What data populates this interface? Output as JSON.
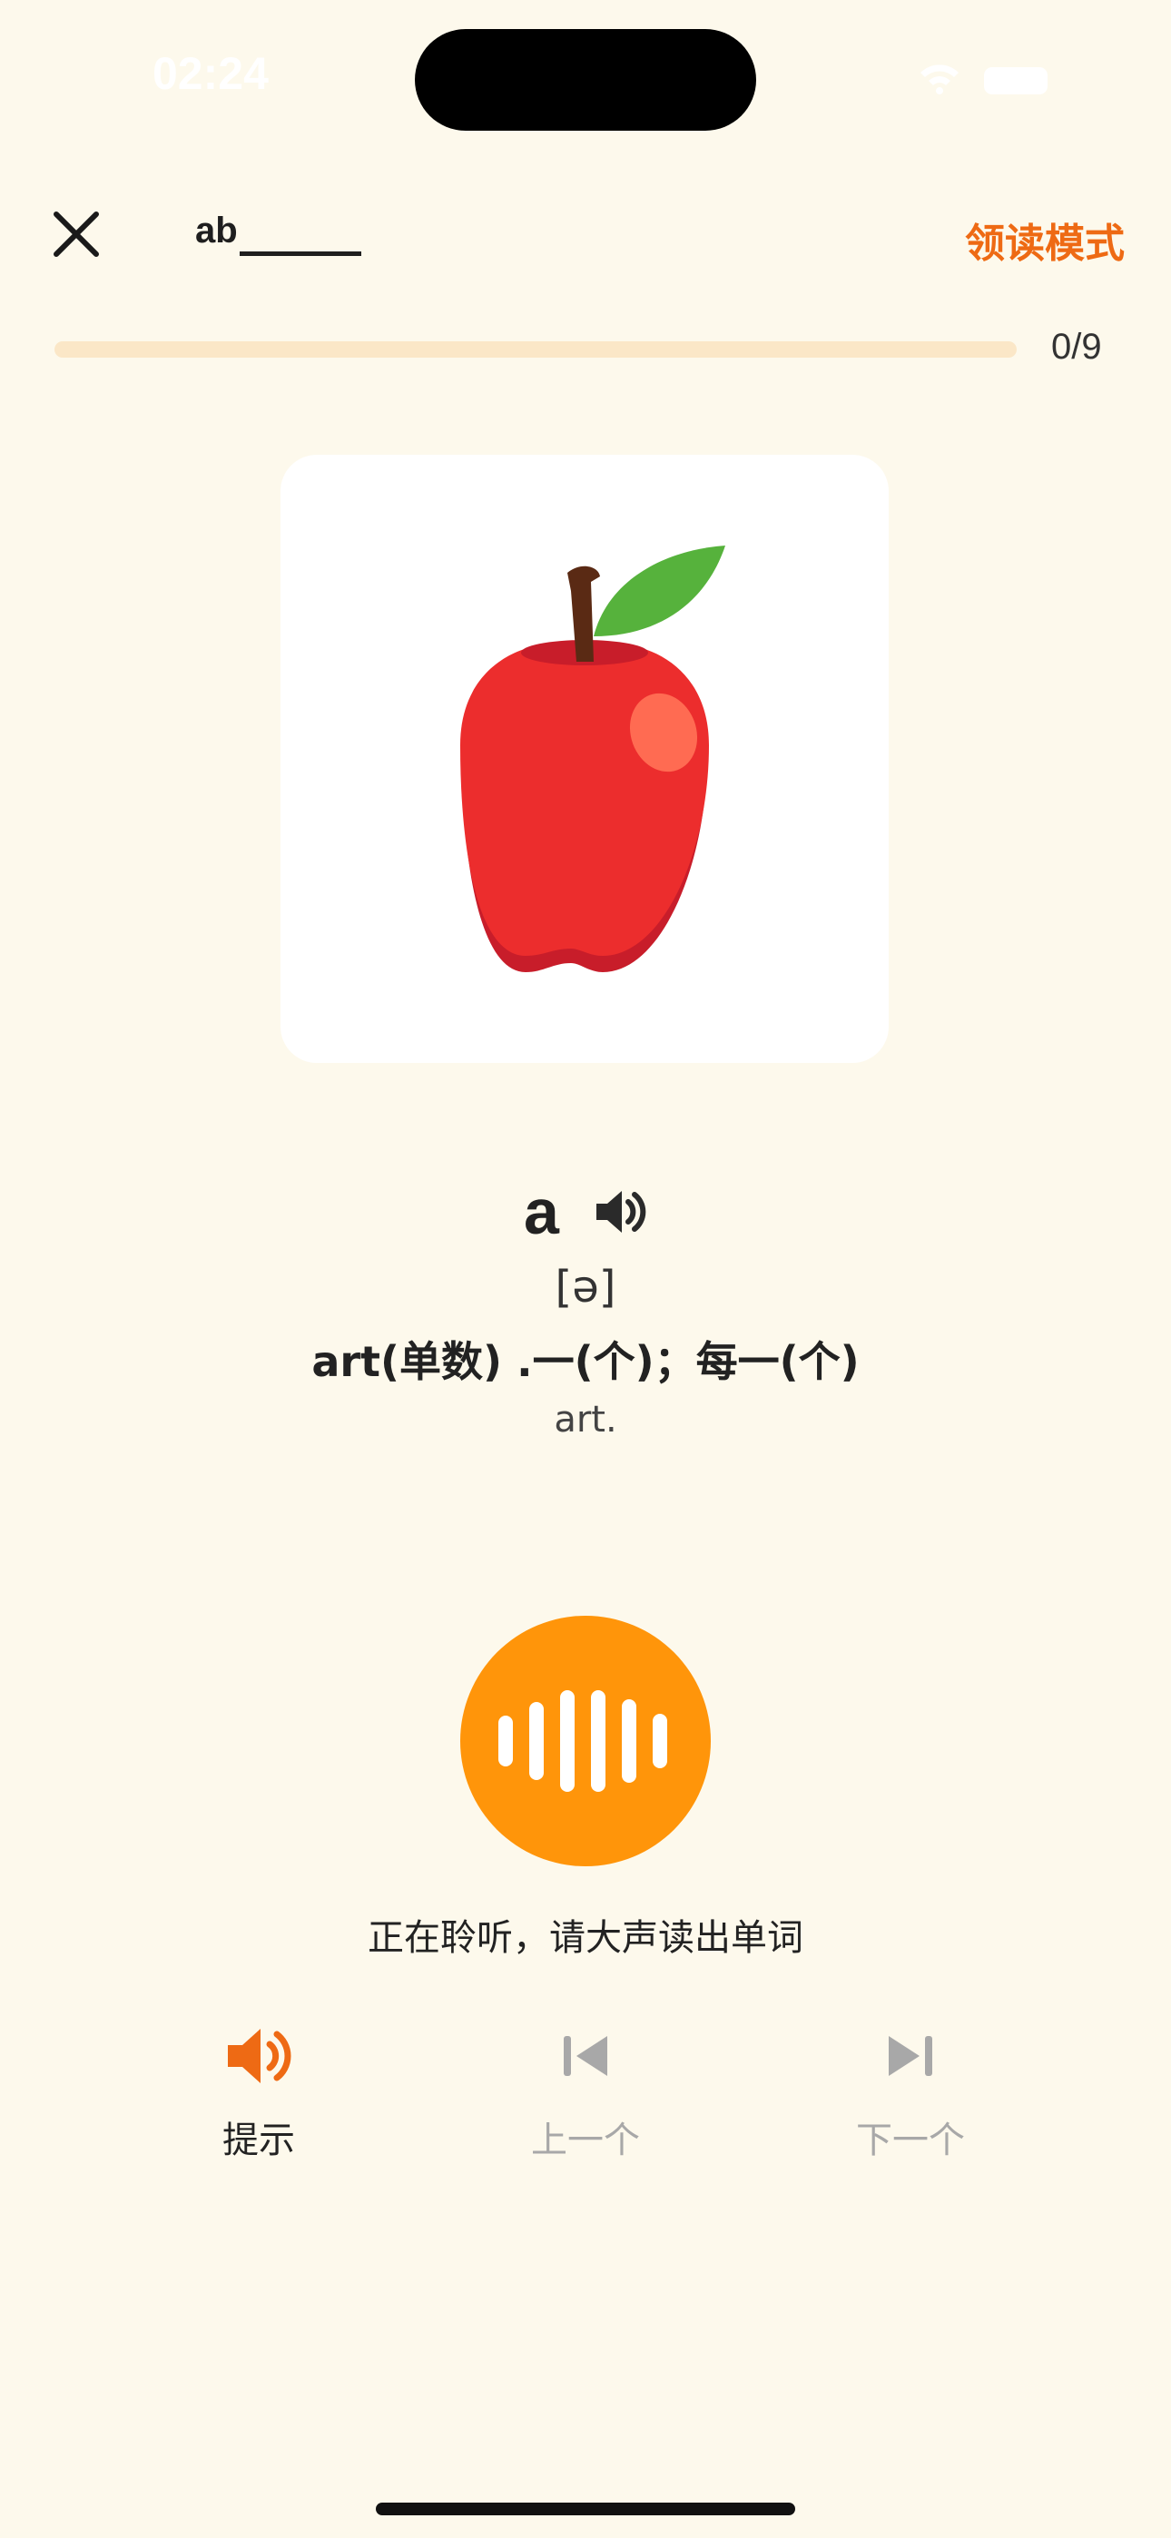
{
  "status_bar": {
    "time": "02:24"
  },
  "header": {
    "word_prefix": "ab",
    "mode_label": "领读模式"
  },
  "progress": {
    "text": "0/9",
    "fraction": 0
  },
  "word": {
    "text": "a",
    "phonetic": "[ə]",
    "meaning": "art(单数) .一(个)；每一(个)",
    "pos": "art."
  },
  "listening_text": "正在聆听，请大声读出单词",
  "controls": {
    "hint_label": "提示",
    "prev_label": "上一个",
    "next_label": "下一个"
  },
  "colors": {
    "accent": "#ee6a14",
    "mic": "#ff950a",
    "disabled": "#a8a8a8",
    "background": "#fdf9ec"
  }
}
